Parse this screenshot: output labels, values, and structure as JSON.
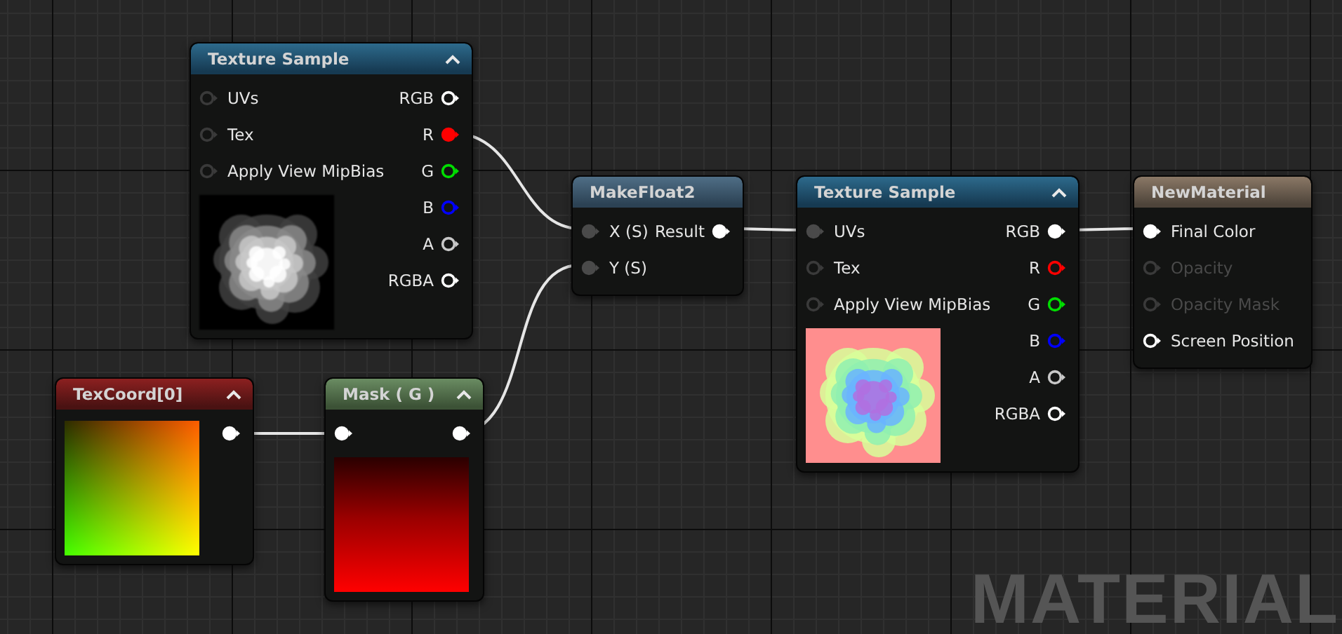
{
  "nodes": [
    {
      "title": "Texture Sample",
      "kind": "texture",
      "collapsible": true,
      "preview": {
        "kind": "noise-gray"
      },
      "inputs": [
        {
          "label": "UVs",
          "connected": false,
          "color": "#3a3a3a"
        },
        {
          "label": "Tex",
          "connected": false,
          "color": "#3a3a3a"
        },
        {
          "label": "Apply View MipBias",
          "connected": false,
          "color": "#3a3a3a"
        }
      ],
      "outputs": [
        {
          "label": "RGB",
          "connected": false,
          "color": "#ffffff"
        },
        {
          "label": "R",
          "connected": true,
          "color": "#ff0000"
        },
        {
          "label": "G",
          "connected": false,
          "color": "#00dd00"
        },
        {
          "label": "B",
          "connected": false,
          "color": "#0000ff"
        },
        {
          "label": "A",
          "connected": false,
          "color": "#c8c8c8"
        },
        {
          "label": "RGBA",
          "connected": false,
          "color": "#ffffff"
        }
      ]
    },
    {
      "title": "TexCoord[0]",
      "kind": "coordinate",
      "collapsible": true,
      "preview": {
        "kind": "gradient-uv"
      },
      "outputs": [
        {
          "connected": true,
          "color": "#ffffff"
        }
      ]
    },
    {
      "title": "Mask ( G )",
      "kind": "mask",
      "collapsible": true,
      "preview": {
        "kind": "gradient-red"
      },
      "inputs": [
        {
          "connected": true,
          "color": "#ffffff"
        }
      ],
      "outputs": [
        {
          "connected": true,
          "color": "#ffffff"
        }
      ]
    },
    {
      "title": "MakeFloat2",
      "kind": "function",
      "collapsible": false,
      "inputs": [
        {
          "label": "X (S)",
          "connected": true,
          "color": "#4a4a4a"
        },
        {
          "label": "Y (S)",
          "connected": true,
          "color": "#4a4a4a"
        }
      ],
      "outputs": [
        {
          "label": "Result",
          "connected": true,
          "color": "#ffffff"
        }
      ]
    },
    {
      "title": "Texture Sample",
      "kind": "texture",
      "collapsible": true,
      "preview": {
        "kind": "noise-heat"
      },
      "inputs": [
        {
          "label": "UVs",
          "connected": true,
          "color": "#4a4a4a"
        },
        {
          "label": "Tex",
          "connected": false,
          "color": "#3a3a3a"
        },
        {
          "label": "Apply View MipBias",
          "connected": false,
          "color": "#3a3a3a"
        }
      ],
      "outputs": [
        {
          "label": "RGB",
          "connected": true,
          "color": "#ffffff"
        },
        {
          "label": "R",
          "connected": false,
          "color": "#ff0000"
        },
        {
          "label": "G",
          "connected": false,
          "color": "#00dd00"
        },
        {
          "label": "B",
          "connected": false,
          "color": "#0000ff"
        },
        {
          "label": "A",
          "connected": false,
          "color": "#c8c8c8"
        },
        {
          "label": "RGBA",
          "connected": false,
          "color": "#ffffff"
        }
      ]
    },
    {
      "title": "NewMaterial",
      "kind": "material",
      "collapsible": false,
      "inputs": [
        {
          "label": "Final Color",
          "connected": true,
          "color": "#ffffff",
          "disabled": false
        },
        {
          "label": "Opacity",
          "connected": false,
          "color": "#3a3a3a",
          "disabled": true
        },
        {
          "label": "Opacity Mask",
          "connected": false,
          "color": "#3a3a3a",
          "disabled": true
        },
        {
          "label": "Screen Position",
          "connected": false,
          "color": "#ffffff",
          "disabled": false
        }
      ]
    }
  ],
  "graph_label": "MATERIAL"
}
